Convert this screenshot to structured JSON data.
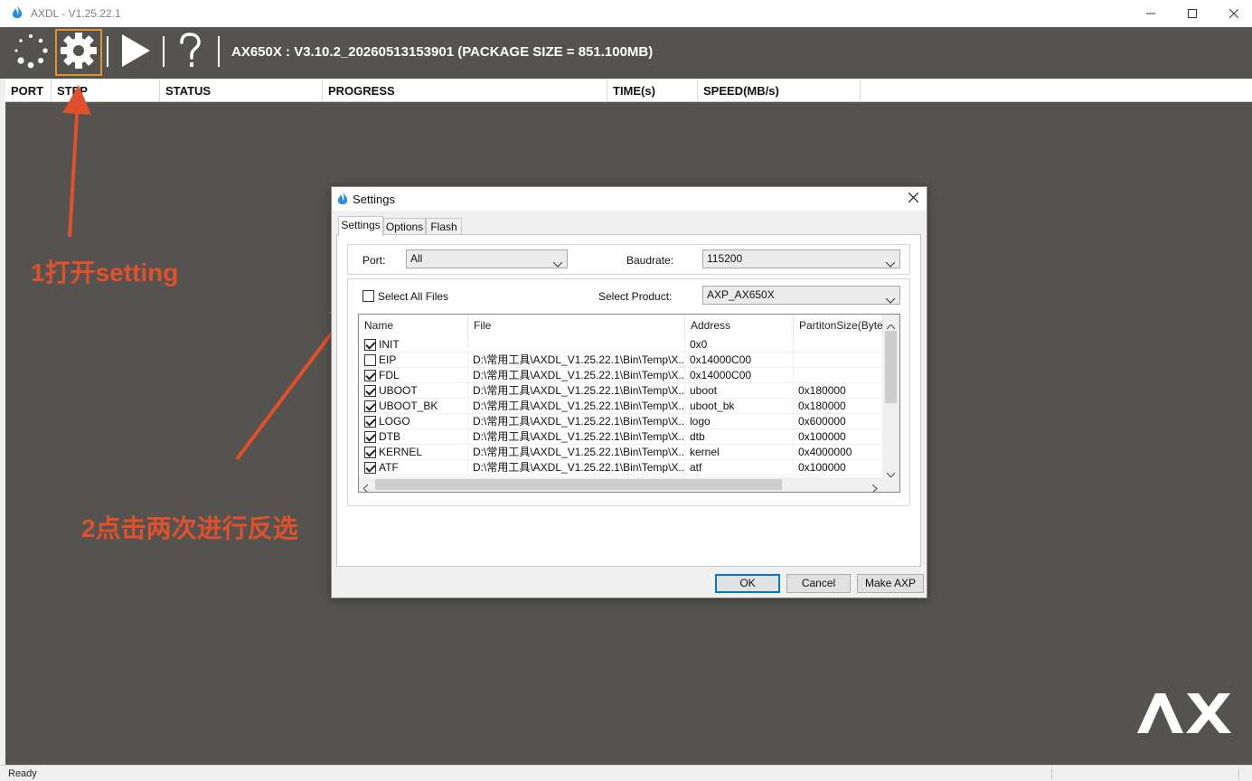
{
  "window": {
    "title": "AXDL - V1.25.22.1",
    "controls": [
      "minimize",
      "maximize",
      "close"
    ]
  },
  "toolbar": {
    "buttons": [
      {
        "icon": "loading-dots-icon",
        "name": "refresh"
      },
      {
        "icon": "gear-icon",
        "name": "settings",
        "active": true
      },
      {
        "icon": "play-icon",
        "name": "start"
      },
      {
        "icon": "help-icon",
        "name": "help"
      }
    ],
    "package_info": "AX650X : V3.10.2_20260513153901 (PACKAGE SIZE = 851.100MB)"
  },
  "columns": [
    "PORT",
    "STEP",
    "STATUS",
    "PROGRESS",
    "TIME(s)",
    "SPEED(MB/s)"
  ],
  "annotations": {
    "step1": "1打开setting",
    "step2": "2点击两次进行反选"
  },
  "colors": {
    "annotation": "#e0502a",
    "background": "#555350",
    "active_border": "#e0922c",
    "accent": "#0078d7"
  },
  "logo_text": "AX",
  "status": {
    "text": "Ready"
  },
  "dialog": {
    "title": "Settings",
    "close_icon": "close-icon",
    "tabs": [
      "Settings",
      "Options",
      "Flash"
    ],
    "active_tab": "Settings",
    "port_label": "Port:",
    "port_value": "All",
    "baudrate_label": "Baudrate:",
    "baudrate_value": "115200",
    "select_all_label": "Select All Files",
    "select_all_checked": false,
    "select_product_label": "Select Product:",
    "product_value": "AXP_AX650X",
    "file_table": {
      "headers": [
        "Name",
        "File",
        "Address",
        "PartitonSize(Bytes)"
      ],
      "rows": [
        {
          "checked": true,
          "name": "INIT",
          "file": "",
          "address": "0x0",
          "size": ""
        },
        {
          "checked": false,
          "name": "EIP",
          "file": "D:\\常用工具\\AXDL_V1.25.22.1\\Bin\\Temp\\X...",
          "address": "0x14000C00",
          "size": ""
        },
        {
          "checked": true,
          "name": "FDL",
          "file": "D:\\常用工具\\AXDL_V1.25.22.1\\Bin\\Temp\\X...",
          "address": "0x14000C00",
          "size": ""
        },
        {
          "checked": true,
          "name": "UBOOT",
          "file": "D:\\常用工具\\AXDL_V1.25.22.1\\Bin\\Temp\\X...",
          "address": "uboot",
          "size": "0x180000"
        },
        {
          "checked": true,
          "name": "UBOOT_BK",
          "file": "D:\\常用工具\\AXDL_V1.25.22.1\\Bin\\Temp\\X...",
          "address": "uboot_bk",
          "size": "0x180000"
        },
        {
          "checked": true,
          "name": "LOGO",
          "file": "D:\\常用工具\\AXDL_V1.25.22.1\\Bin\\Temp\\X...",
          "address": "logo",
          "size": "0x600000"
        },
        {
          "checked": true,
          "name": "DTB",
          "file": "D:\\常用工具\\AXDL_V1.25.22.1\\Bin\\Temp\\X...",
          "address": "dtb",
          "size": "0x100000"
        },
        {
          "checked": true,
          "name": "KERNEL",
          "file": "D:\\常用工具\\AXDL_V1.25.22.1\\Bin\\Temp\\X...",
          "address": "kernel",
          "size": "0x4000000"
        },
        {
          "checked": true,
          "name": "ATF",
          "file": "D:\\常用工具\\AXDL_V1.25.22.1\\Bin\\Temp\\X...",
          "address": "atf",
          "size": "0x100000"
        }
      ]
    },
    "buttons": {
      "ok": "OK",
      "cancel": "Cancel",
      "make": "Make AXP"
    }
  }
}
